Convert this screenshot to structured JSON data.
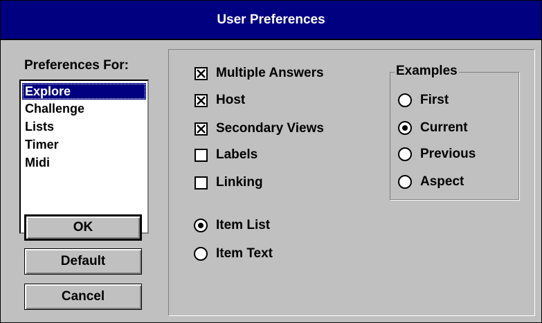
{
  "window": {
    "title": "User Preferences"
  },
  "preferences_for": {
    "label": "Preferences For:",
    "items": [
      "Explore",
      "Challenge",
      "Lists",
      "Timer",
      "Midi"
    ],
    "selected": "Explore"
  },
  "buttons": {
    "ok": "OK",
    "default": "Default",
    "cancel": "Cancel"
  },
  "options": {
    "checkboxes": [
      {
        "label": "Multiple Answers",
        "checked": true
      },
      {
        "label": "Host",
        "checked": true
      },
      {
        "label": "Secondary Views",
        "checked": true
      },
      {
        "label": "Labels",
        "checked": false
      },
      {
        "label": "Linking",
        "checked": false
      }
    ],
    "item_mode": [
      {
        "label": "Item List",
        "selected": true
      },
      {
        "label": "Item Text",
        "selected": false
      }
    ]
  },
  "examples": {
    "label": "Examples",
    "options": [
      {
        "label": "First",
        "selected": false
      },
      {
        "label": "Current",
        "selected": true
      },
      {
        "label": "Previous",
        "selected": false
      },
      {
        "label": "Aspect",
        "selected": false
      }
    ]
  },
  "colors": {
    "title_bar": "#000080",
    "face": "#c0c0c0",
    "selection": "#000080"
  }
}
